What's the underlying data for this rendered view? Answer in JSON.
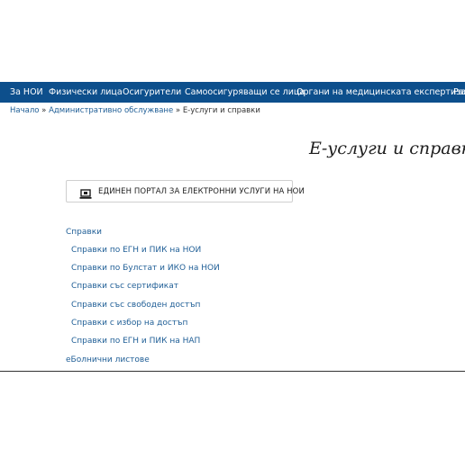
{
  "nav": {
    "items": [
      {
        "label": "За НОИ"
      },
      {
        "label": "Физически лица"
      },
      {
        "label": "Осигурители"
      },
      {
        "label": "Самоосигуряващи се лица"
      },
      {
        "label": "Органи на медицинската експертиза"
      },
      {
        "label": "Раз"
      }
    ]
  },
  "breadcrumb": {
    "home": "Начало",
    "separator": "»",
    "section": "Административно обслужване",
    "current": "Е-услуги и справки"
  },
  "page": {
    "title": "Е-услуги и справки"
  },
  "portal": {
    "label": "ЕДИНЕН ПОРТАЛ ЗА ЕЛЕКТРОННИ УСЛУГИ НА НОИ",
    "icon": "laptop-icon"
  },
  "menu": {
    "spravki": "Справки",
    "items": [
      {
        "label": "Справки по ЕГН и ПИК на НОИ"
      },
      {
        "label": "Справки по Булстат и ИКО на НОИ"
      },
      {
        "label": "Справки със сертификат"
      },
      {
        "label": "Справки със свободен достъп"
      },
      {
        "label": "Справки с избор на достъп"
      },
      {
        "label": "Справки по ЕГН и ПИК на НАП"
      }
    ],
    "ebolnichni": "еБолнични листове"
  },
  "colors": {
    "nav_background": "#0d4f8c",
    "link": "#1f5e96"
  }
}
